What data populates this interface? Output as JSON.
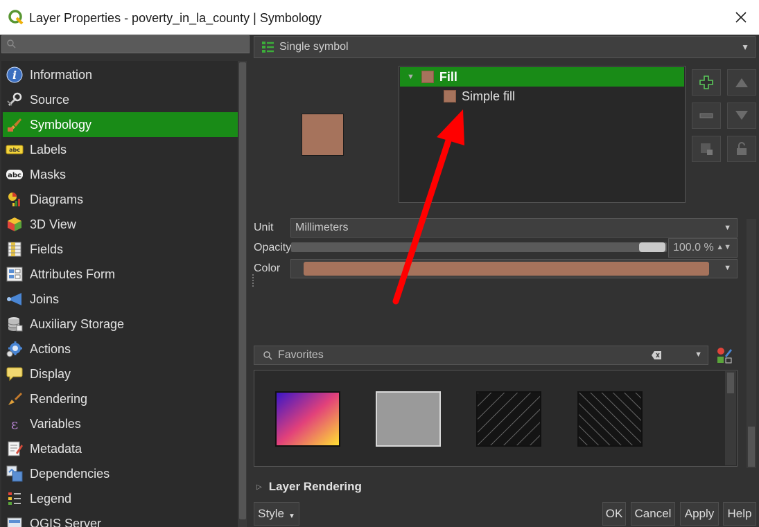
{
  "window": {
    "title": "Layer Properties - poverty_in_la_county | Symbology"
  },
  "sidebar": {
    "search_placeholder": "",
    "items": [
      {
        "label": "Information",
        "icon": "info-icon"
      },
      {
        "label": "Source",
        "icon": "source-icon"
      },
      {
        "label": "Symbology",
        "icon": "symbology-icon",
        "active": true
      },
      {
        "label": "Labels",
        "icon": "labels-icon"
      },
      {
        "label": "Masks",
        "icon": "masks-icon"
      },
      {
        "label": "Diagrams",
        "icon": "diagrams-icon"
      },
      {
        "label": "3D View",
        "icon": "3d-view-icon"
      },
      {
        "label": "Fields",
        "icon": "fields-icon"
      },
      {
        "label": "Attributes Form",
        "icon": "attributes-form-icon"
      },
      {
        "label": "Joins",
        "icon": "joins-icon"
      },
      {
        "label": "Auxiliary Storage",
        "icon": "auxiliary-storage-icon"
      },
      {
        "label": "Actions",
        "icon": "actions-icon"
      },
      {
        "label": "Display",
        "icon": "display-icon"
      },
      {
        "label": "Rendering",
        "icon": "rendering-icon"
      },
      {
        "label": "Variables",
        "icon": "variables-icon"
      },
      {
        "label": "Metadata",
        "icon": "metadata-icon"
      },
      {
        "label": "Dependencies",
        "icon": "dependencies-icon"
      },
      {
        "label": "Legend",
        "icon": "legend-icon"
      },
      {
        "label": "QGIS Server",
        "icon": "qgis-server-icon"
      }
    ]
  },
  "symbology": {
    "renderer": "Single symbol",
    "tree": {
      "root": "Fill",
      "child": "Simple fill"
    },
    "unit_label": "Unit",
    "unit_value": "Millimeters",
    "opacity_label": "Opacity",
    "opacity_value": "100.0 %",
    "opacity_fraction": 1.0,
    "color_label": "Color",
    "fill_color": "#a6735c",
    "favorites_placeholder": "Favorites"
  },
  "footer": {
    "layer_rendering": "Layer Rendering",
    "style": "Style",
    "ok": "OK",
    "cancel": "Cancel",
    "apply": "Apply",
    "help": "Help"
  },
  "colors": {
    "accent_green": "#198b17",
    "annotation_red": "#ff0000"
  }
}
